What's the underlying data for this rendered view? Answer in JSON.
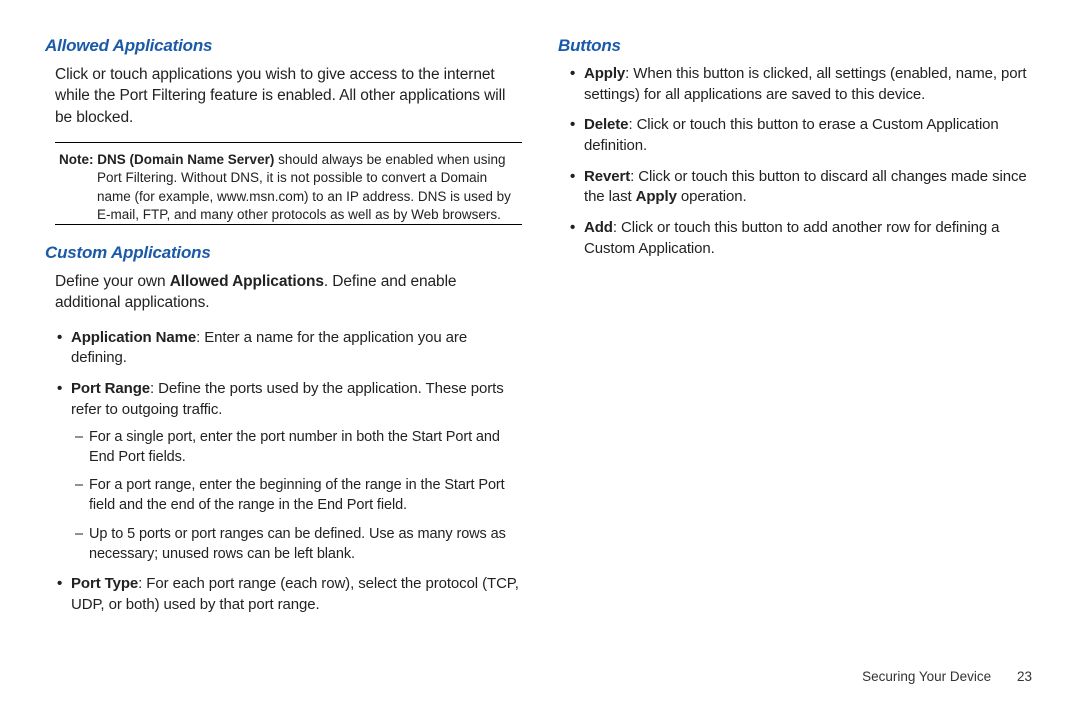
{
  "left": {
    "allowed": {
      "heading": "Allowed Applications",
      "body": "Click or touch applications you wish to give access to the internet while the Port Filtering feature is enabled. All other applications will be blocked.",
      "note_label": "Note:",
      "note_strong": "DNS (Domain Name Server)",
      "note_rest": " should always be enabled when using Port Filtering. Without DNS, it is not possible to convert a Domain name (for example, www.msn.com) to an IP address. DNS is used by E-mail, FTP, and many other protocols as well as by Web browsers."
    },
    "custom": {
      "heading": "Custom Applications",
      "intro_pre": "Define your own ",
      "intro_bold": "Allowed Applications",
      "intro_post": ". Define and enable additional applications.",
      "items": [
        {
          "label": "Application Name",
          "text": ": Enter a name for the application you are defining."
        },
        {
          "label": "Port Range",
          "text": ": Define the ports used by the application. These ports refer to outgoing traffic."
        },
        {
          "label": "Port Type",
          "text": ": For each port range (each row), select the protocol (TCP, UDP, or both) used by that port range."
        }
      ],
      "dashes": [
        "For a single port, enter the port number in both the Start Port and End Port fields.",
        "For a port range, enter the beginning of the range in the Start Port field and the end of the range in the End Port field.",
        "Up to 5 ports or port ranges can be defined. Use as many rows as necessary; unused rows can be left blank."
      ]
    }
  },
  "right": {
    "buttons": {
      "heading": "Buttons",
      "items": [
        {
          "label": "Apply",
          "text": ": When this button is clicked, all settings (enabled, name, port settings) for all applications are saved to this device."
        },
        {
          "label": "Delete",
          "text": ": Click or touch this button to erase a Custom Application definition."
        },
        {
          "label": "Add",
          "text": ": Click or touch this button to add another row for defining a Custom Application."
        }
      ],
      "revert_label": "Revert",
      "revert_pre": ": Click or touch this button to discard all changes made since the last ",
      "revert_bold": "Apply",
      "revert_post": " operation."
    }
  },
  "footer": {
    "section": "Securing Your Device",
    "page": "23"
  }
}
